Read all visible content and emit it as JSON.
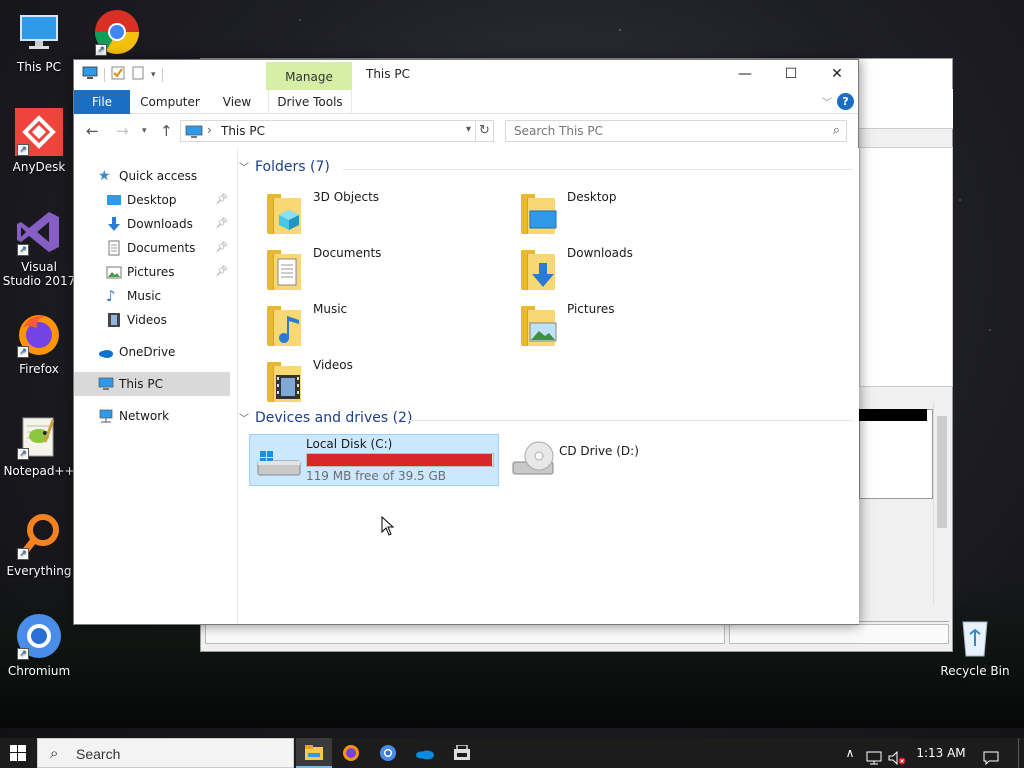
{
  "desktop": {
    "icons": [
      {
        "label": "This PC"
      },
      {
        "label": ""
      },
      {
        "label": "AnyDesk"
      },
      {
        "label": "Visual Studio 2017"
      },
      {
        "label": "Firefox"
      },
      {
        "label": "Notepad++"
      },
      {
        "label": "Everything"
      },
      {
        "label": "Chromium"
      },
      {
        "label": "Recycle Bin"
      }
    ]
  },
  "window": {
    "title": "This PC",
    "contextual_tab": "Manage",
    "controls": {
      "minimize": "—",
      "maximize": "☐",
      "close": "✕"
    }
  },
  "ribbon": {
    "tabs": [
      "File",
      "Computer",
      "View",
      "Drive Tools"
    ],
    "help": "?"
  },
  "address": {
    "crumb": "This PC",
    "search_placeholder": "Search This PC"
  },
  "nav_pane": {
    "items": [
      {
        "label": "Quick access",
        "icon": "star-icon"
      },
      {
        "label": "Desktop",
        "icon": "desktop-icon",
        "pinned": true
      },
      {
        "label": "Downloads",
        "icon": "download-arrow-icon",
        "pinned": true
      },
      {
        "label": "Documents",
        "icon": "document-icon",
        "pinned": true
      },
      {
        "label": "Pictures",
        "icon": "picture-icon",
        "pinned": true
      },
      {
        "label": "Music",
        "icon": "music-note-icon"
      },
      {
        "label": "Videos",
        "icon": "film-icon"
      },
      {
        "label": "OneDrive",
        "icon": "cloud-icon"
      },
      {
        "label": "This PC",
        "icon": "monitor-icon",
        "selected": true
      },
      {
        "label": "Network",
        "icon": "network-icon"
      }
    ]
  },
  "content": {
    "folders_header": "Folders (7)",
    "folders": [
      {
        "name": "3D Objects",
        "overlay": "cube-icon"
      },
      {
        "name": "Desktop",
        "overlay": "desktop-icon"
      },
      {
        "name": "Documents",
        "overlay": "document-icon"
      },
      {
        "name": "Downloads",
        "overlay": "download-arrow-icon"
      },
      {
        "name": "Music",
        "overlay": "music-note-icon"
      },
      {
        "name": "Pictures",
        "overlay": "picture-icon"
      },
      {
        "name": "Videos",
        "overlay": "film-icon"
      }
    ],
    "drives_header": "Devices and drives (2)",
    "drives": [
      {
        "name": "Local Disk (C:)",
        "free": "119 MB free of 39.5 GB",
        "used_fraction": 0.997,
        "bar_color": "#da2626",
        "selected": true
      },
      {
        "name": "CD Drive (D:)"
      }
    ]
  },
  "taskbar": {
    "search_placeholder": "Search",
    "clock": "1:13 AM",
    "apps": [
      "file-explorer-icon",
      "firefox-icon",
      "chromium-icon",
      "onedrive-icon",
      "store-icon"
    ]
  }
}
